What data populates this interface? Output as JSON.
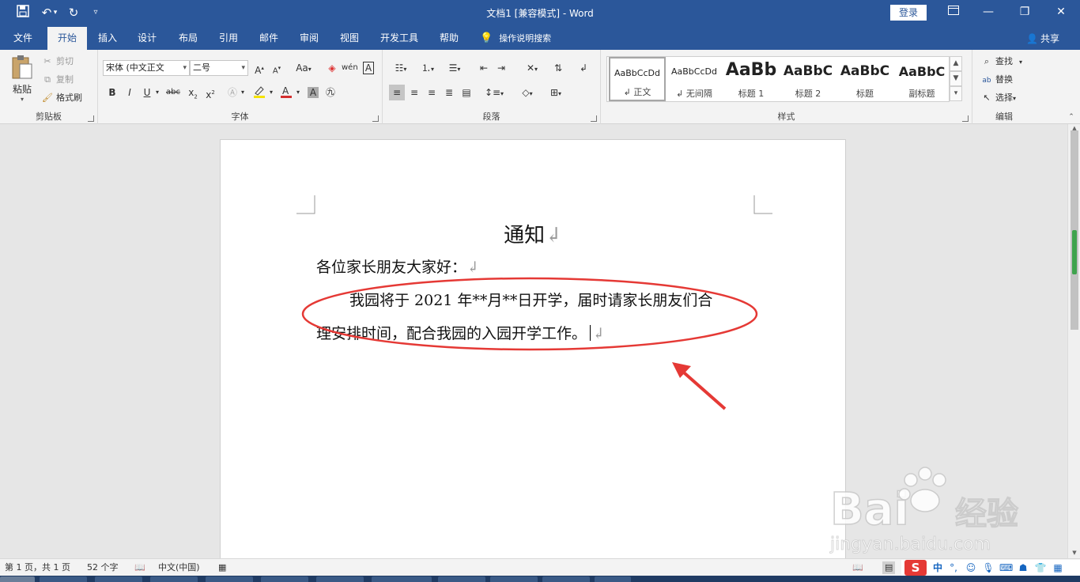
{
  "window": {
    "title": "文档1 [兼容模式]  -  Word",
    "login": "登录"
  },
  "tabs": [
    {
      "label": "文件",
      "active": false
    },
    {
      "label": "开始",
      "active": true
    },
    {
      "label": "插入",
      "active": false
    },
    {
      "label": "设计",
      "active": false
    },
    {
      "label": "布局",
      "active": false
    },
    {
      "label": "引用",
      "active": false
    },
    {
      "label": "邮件",
      "active": false
    },
    {
      "label": "审阅",
      "active": false
    },
    {
      "label": "视图",
      "active": false
    },
    {
      "label": "开发工具",
      "active": false
    },
    {
      "label": "帮助",
      "active": false
    }
  ],
  "tell_me": "操作说明搜索",
  "share": "共享",
  "clipboard": {
    "paste": "粘贴",
    "cut": "剪切",
    "copy": "复制",
    "format_painter": "格式刷",
    "label": "剪贴板"
  },
  "font": {
    "name": "宋体 (中文正文",
    "size": "二号",
    "case": "Aa",
    "label": "字体"
  },
  "paragraph": {
    "label": "段落"
  },
  "styles": {
    "items": [
      {
        "preview": "AaBbCcDd",
        "name": "↲ 正文"
      },
      {
        "preview": "AaBbCcDd",
        "name": "↲ 无间隔"
      },
      {
        "preview": "AaBb",
        "name": "标题 1"
      },
      {
        "preview": "AaBbC",
        "name": "标题 2"
      },
      {
        "preview": "AaBbC",
        "name": "标题"
      },
      {
        "preview": "AaBbC",
        "name": "副标题"
      }
    ],
    "label": "样式"
  },
  "editing": {
    "find": "查找",
    "replace": "替换",
    "select": "选择",
    "label": "编辑"
  },
  "document": {
    "title": "通知",
    "greeting": "各位家长朋友大家好：",
    "line1": "我园将于 2021 年**月**日开学，届时请家长朋友们合",
    "line2": "理安排时间，配合我园的入园开学工作。"
  },
  "status": {
    "page": "第 1 页，共 1 页",
    "words": "52 个字",
    "language": "中文(中国)"
  },
  "ime": {
    "logo": "S",
    "mode": "中"
  },
  "watermark": {
    "brand": "Bai",
    "brand_cn": "经验",
    "url": "jingyan.baidu.com"
  },
  "colors": {
    "accent": "#2b579a",
    "annotation": "#e53935",
    "highlight": "#f5e300",
    "font_color": "#d32f2f"
  },
  "icons": [
    "save-icon",
    "undo-icon",
    "redo-icon",
    "customize-qat-icon",
    "ribbon-display-icon",
    "minimize-icon",
    "restore-icon",
    "close-icon",
    "lightbulb-icon",
    "share-icon",
    "paste-icon",
    "cut-icon",
    "copy-icon",
    "format-painter-icon",
    "search-icon",
    "replace-icon",
    "select-icon",
    "read-mode-icon",
    "print-layout-icon",
    "web-layout-icon",
    "sogou-ime-icon"
  ]
}
